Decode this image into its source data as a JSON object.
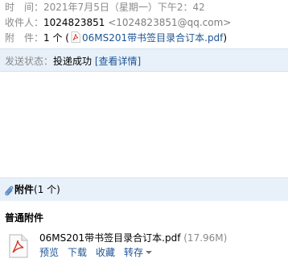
{
  "header": {
    "time_label": "时　间：",
    "time_value": "2021年7月5日（星期一）下午2：42",
    "to_label": "收件人：",
    "to_name": "1024823851",
    "to_email": "<1024823851@qq.com>",
    "attach_label": "附　件：",
    "attach_count": "1 个",
    "attach_open": "(",
    "attach_file": "06MS201带书签目录合订本.pdf",
    "attach_close": ")"
  },
  "status": {
    "label": "发送状态：",
    "value": "投递成功",
    "details": "[查看详情]"
  },
  "attachments": {
    "title": "附件",
    "count": "(1 个)",
    "section_label": "普通附件",
    "file": {
      "name": "06MS201带书签目录合订本.pdf",
      "size": "(17.96M)"
    },
    "actions": {
      "preview": "预览",
      "download": "下载",
      "favorite": "收藏",
      "forward": "转存"
    }
  },
  "colors": {
    "link": "#1e5494",
    "status_bar_bg": "#e8f0f9",
    "label_gray": "#8a8a8a",
    "pdf_red": "#d93025"
  }
}
